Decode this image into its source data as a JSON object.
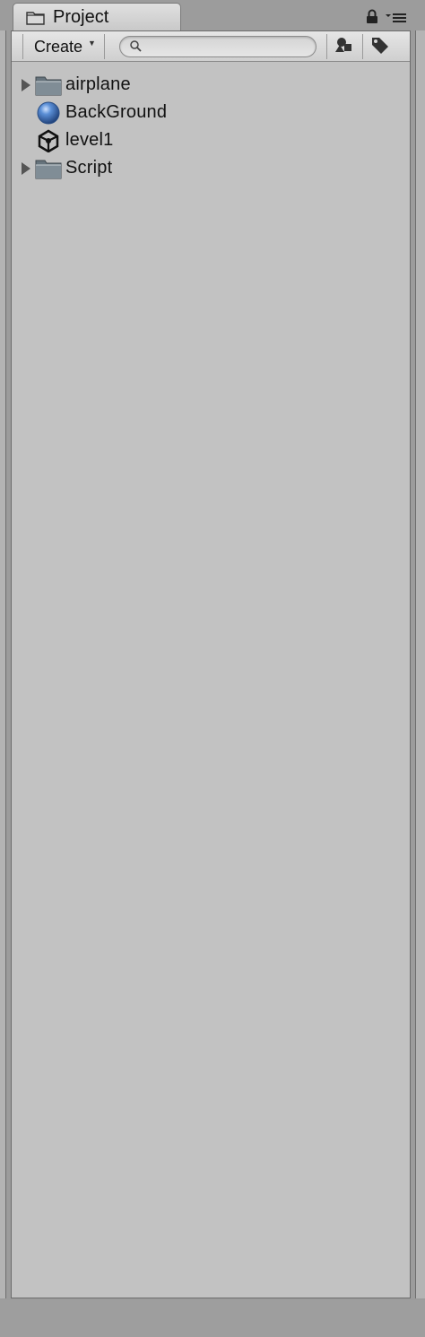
{
  "tab": {
    "title": "Project",
    "icon": "folder-icon"
  },
  "controls": {
    "lock_icon": "lock-icon",
    "menu_icon": "panel-menu-icon"
  },
  "toolbar": {
    "create_label": "Create",
    "search_placeholder": "",
    "search_value": "",
    "filter_type_icon": "filter-by-type-icon",
    "filter_label_icon": "filter-by-label-icon"
  },
  "tree": {
    "items": [
      {
        "label": "airplane",
        "icon": "folder-icon",
        "expandable": true
      },
      {
        "label": "BackGround",
        "icon": "material-sphere-icon",
        "expandable": false
      },
      {
        "label": "level1",
        "icon": "unity-scene-icon",
        "expandable": false
      },
      {
        "label": "Script",
        "icon": "folder-icon",
        "expandable": true
      }
    ]
  },
  "colors": {
    "panel_bg": "#c2c2c2",
    "window_bg": "#9c9c9c",
    "folder": "#6f7c85",
    "sphere": "#3d6fb6"
  }
}
